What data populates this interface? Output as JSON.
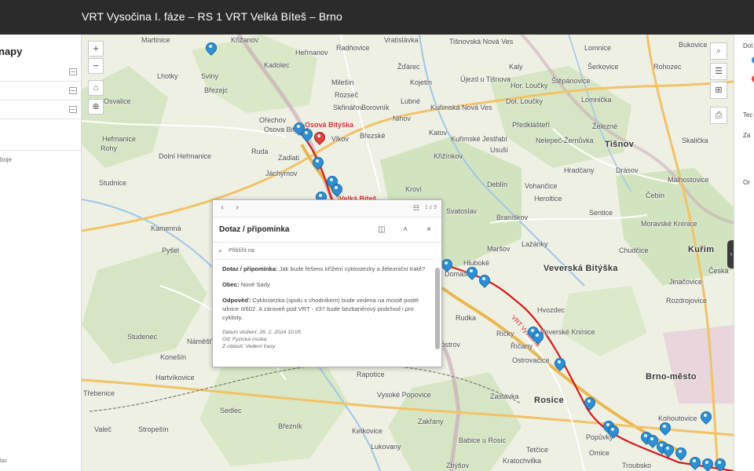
{
  "header": {
    "title": "VRT Vysočina I. fáze – RS 1 VRT Velká Bíteš – Brno"
  },
  "left_panel": {
    "title": "napy",
    "note": "boje",
    "footer": "lac"
  },
  "map_controls": {
    "zoom_in": "+",
    "zoom_out": "−"
  },
  "map": {
    "route_label": "VRT Vysočina",
    "highlight_label": "Osová Bitýška",
    "highlight_label_2": "Velká Bíteš",
    "places": [
      {
        "name": "Martinice",
        "big": false
      },
      {
        "name": "Křižanov",
        "big": false
      },
      {
        "name": "Heřmanov",
        "big": false
      },
      {
        "name": "Radňovice",
        "big": false
      },
      {
        "name": "Vratislávka",
        "big": false
      },
      {
        "name": "Tišnovská Nová Ves",
        "big": false
      },
      {
        "name": "Bukovice",
        "big": false
      },
      {
        "name": "Lomnice",
        "big": false
      },
      {
        "name": "Kadolec",
        "big": false
      },
      {
        "name": "Ořechov",
        "big": false
      },
      {
        "name": "Žďárec",
        "big": false
      },
      {
        "name": "Kaly",
        "big": false
      },
      {
        "name": "Šerkovice",
        "big": false
      },
      {
        "name": "Rohozec",
        "big": false
      },
      {
        "name": "Lhotky",
        "big": false
      },
      {
        "name": "Sviny",
        "big": false
      },
      {
        "name": "Březejc",
        "big": false
      },
      {
        "name": "Milešín",
        "big": false
      },
      {
        "name": "Rozseč",
        "big": false
      },
      {
        "name": "Kojetín",
        "big": false
      },
      {
        "name": "Újezd u Tišnova",
        "big": false
      },
      {
        "name": "Štěpánovice",
        "big": false
      },
      {
        "name": "Osvalice",
        "big": false
      },
      {
        "name": "Skřinářov",
        "big": false
      },
      {
        "name": "Borovník",
        "big": false
      },
      {
        "name": "Lubné",
        "big": false
      },
      {
        "name": "Hor. Loučky",
        "big": false
      },
      {
        "name": "Dol. Loučky",
        "big": false
      },
      {
        "name": "Lomnička",
        "big": false
      },
      {
        "name": "Osova Bitýška",
        "big": false
      },
      {
        "name": "Vlkov",
        "big": false
      },
      {
        "name": "Nihov",
        "big": false
      },
      {
        "name": "Kuřimská Nová Ves",
        "big": false
      },
      {
        "name": "Předklášteří",
        "big": false
      },
      {
        "name": "Železné",
        "big": false
      },
      {
        "name": "Ruda",
        "big": false
      },
      {
        "name": "Březské",
        "big": false
      },
      {
        "name": "Katov",
        "big": false
      },
      {
        "name": "Kuřimské Jestřabí",
        "big": false
      },
      {
        "name": "Nelepeč-Žernůvka",
        "big": false
      },
      {
        "name": "Tišnov",
        "big": true
      },
      {
        "name": "Skalička",
        "big": false
      },
      {
        "name": "Hefmanice",
        "big": false
      },
      {
        "name": "Dolní Heřmanice",
        "big": false
      },
      {
        "name": "Zadlati",
        "big": false
      },
      {
        "name": "Jáchymov",
        "big": false
      },
      {
        "name": "Křižínkov",
        "big": false
      },
      {
        "name": "Usuší",
        "big": false
      },
      {
        "name": "Hradčany",
        "big": false
      },
      {
        "name": "Drásov",
        "big": false
      },
      {
        "name": "Malhostovice",
        "big": false
      },
      {
        "name": "Rohy",
        "big": false
      },
      {
        "name": "Kroví",
        "big": false
      },
      {
        "name": "Deblín",
        "big": false
      },
      {
        "name": "Vohančice",
        "big": false
      },
      {
        "name": "Heroltice",
        "big": false
      },
      {
        "name": "Čebín",
        "big": false
      },
      {
        "name": "Studnice",
        "big": false
      },
      {
        "name": "Svatoslav",
        "big": false
      },
      {
        "name": "Braníškov",
        "big": false
      },
      {
        "name": "Sentice",
        "big": false
      },
      {
        "name": "Moravské Knínice",
        "big": false
      },
      {
        "name": "Kamenná",
        "big": false
      },
      {
        "name": "Lažánky",
        "big": false
      },
      {
        "name": "Chudčice",
        "big": false
      },
      {
        "name": "Kuřim",
        "big": true
      },
      {
        "name": "Pyšel",
        "big": false
      },
      {
        "name": "Maršov",
        "big": false
      },
      {
        "name": "Veverská Bitýška",
        "big": true
      },
      {
        "name": "Česká",
        "big": false
      },
      {
        "name": "Jinačovice",
        "big": false
      },
      {
        "name": "Rozdrojovice",
        "big": false
      },
      {
        "name": "Hluboké",
        "big": false
      },
      {
        "name": "Domašov",
        "big": false
      },
      {
        "name": "Hvozdec",
        "big": false
      },
      {
        "name": "Rudka",
        "big": false
      },
      {
        "name": "Ríčky",
        "big": false
      },
      {
        "name": "Veverské Knínice",
        "big": false
      },
      {
        "name": "Studenec",
        "big": false
      },
      {
        "name": "Litostrov",
        "big": false
      },
      {
        "name": "Říčany",
        "big": false
      },
      {
        "name": "Ostrovačice",
        "big": false
      },
      {
        "name": "Rapotice",
        "big": false
      },
      {
        "name": "Vysoké Popovice",
        "big": false
      },
      {
        "name": "Zastávka",
        "big": false
      },
      {
        "name": "Brno-město",
        "big": true
      },
      {
        "name": "Hartvíkovice",
        "big": false
      },
      {
        "name": "Třebenice",
        "big": false
      },
      {
        "name": "Sedlec",
        "big": false
      },
      {
        "name": "Rosice",
        "big": true
      },
      {
        "name": "Kohoutovice",
        "big": false
      },
      {
        "name": "Popůvky",
        "big": false
      },
      {
        "name": "Valeč",
        "big": false
      },
      {
        "name": "Stropešín",
        "big": false
      },
      {
        "name": "Březník",
        "big": false
      },
      {
        "name": "Ketkovice",
        "big": false
      },
      {
        "name": "Zakřany",
        "big": false
      },
      {
        "name": "Babice u Rosic",
        "big": false
      },
      {
        "name": "Omice",
        "big": false
      },
      {
        "name": "Lukovany",
        "big": false
      },
      {
        "name": "Tetčice",
        "big": false
      },
      {
        "name": "Troubsko",
        "big": false
      },
      {
        "name": "Zbýšov",
        "big": false
      },
      {
        "name": "Kratochvilka",
        "big": false
      },
      {
        "name": "Konešín",
        "big": false
      },
      {
        "name": "Náměšť nad Oslavou",
        "big": false
      }
    ]
  },
  "popup": {
    "page_count": "1 z 9",
    "title": "Dotaz / připomínka",
    "zoom_label": "Přiblížit na",
    "fields": [
      {
        "label": "Dotaz / připomínka:",
        "value": "Jak bude řešeno křížení cyklostezky a železniční tratě?"
      },
      {
        "label": "Obec:",
        "value": "Nové Sady"
      },
      {
        "label": "Odpověď:",
        "value": "Cyklostezka (spolu s chodníkem) bude vedena na mostě podél silnice II/602. A zároveň pod VRT - I/37 bude bezbariérový podchod i pro cyklisty."
      }
    ],
    "meta": [
      {
        "label": "Datum vložení:",
        "value": "26. 2. 2024 10:05"
      },
      {
        "label": "Od:",
        "value": "Fyzická osoba"
      },
      {
        "label": "Z oblasti:",
        "value": "Vedení trasy"
      }
    ]
  },
  "right_panel": {
    "label_1": "Dot",
    "label_2": "Tec",
    "label_3": "Za",
    "label_4": "Or",
    "dot_colors": [
      "#2e8fd2",
      "#e04040"
    ]
  },
  "colors": {
    "header_bg": "#2b2b2b",
    "route": "#d01c1c",
    "pin_blue": "#2e8fd2",
    "pin_red": "#e04040"
  }
}
